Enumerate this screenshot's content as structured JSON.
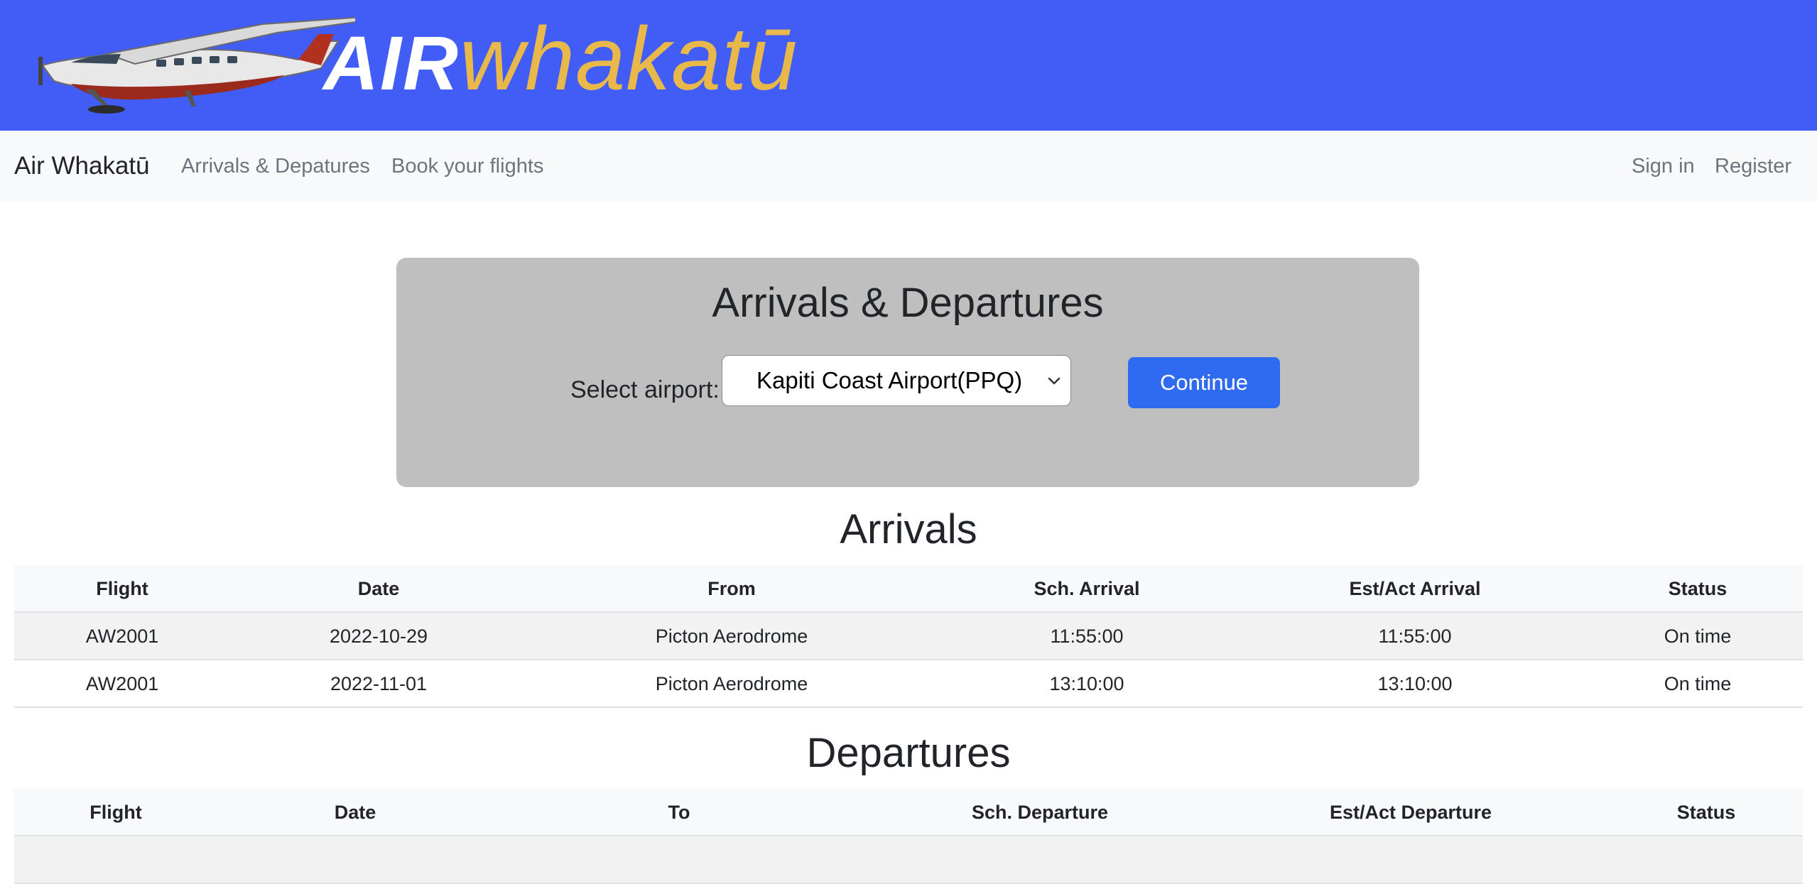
{
  "banner": {
    "logo_air": "AIR",
    "logo_whakatu": "whakatū",
    "color": "#425df6",
    "logo_accent": "#e9b84a"
  },
  "navbar": {
    "brand": "Air Whakatū",
    "links": [
      "Arrivals & Depatures",
      "Book your flights"
    ],
    "sign_in": "Sign in",
    "register": "Register"
  },
  "panel": {
    "title": "Arrivals & Departures",
    "select_label": "Select airport:",
    "selected_airport": "Kapiti Coast Airport(PPQ)",
    "continue_label": "Continue"
  },
  "arrivals": {
    "title": "Arrivals",
    "columns": [
      "Flight",
      "Date",
      "From",
      "Sch. Arrival",
      "Est/Act Arrival",
      "Status"
    ],
    "rows": [
      [
        "AW2001",
        "2022-10-29",
        "Picton Aerodrome",
        "11:55:00",
        "11:55:00",
        "On time"
      ],
      [
        "AW2001",
        "2022-11-01",
        "Picton Aerodrome",
        "13:10:00",
        "13:10:00",
        "On time"
      ]
    ]
  },
  "departures": {
    "title": "Departures",
    "columns": [
      "Flight",
      "Date",
      "To",
      "Sch. Departure",
      "Est/Act Departure",
      "Status"
    ]
  }
}
